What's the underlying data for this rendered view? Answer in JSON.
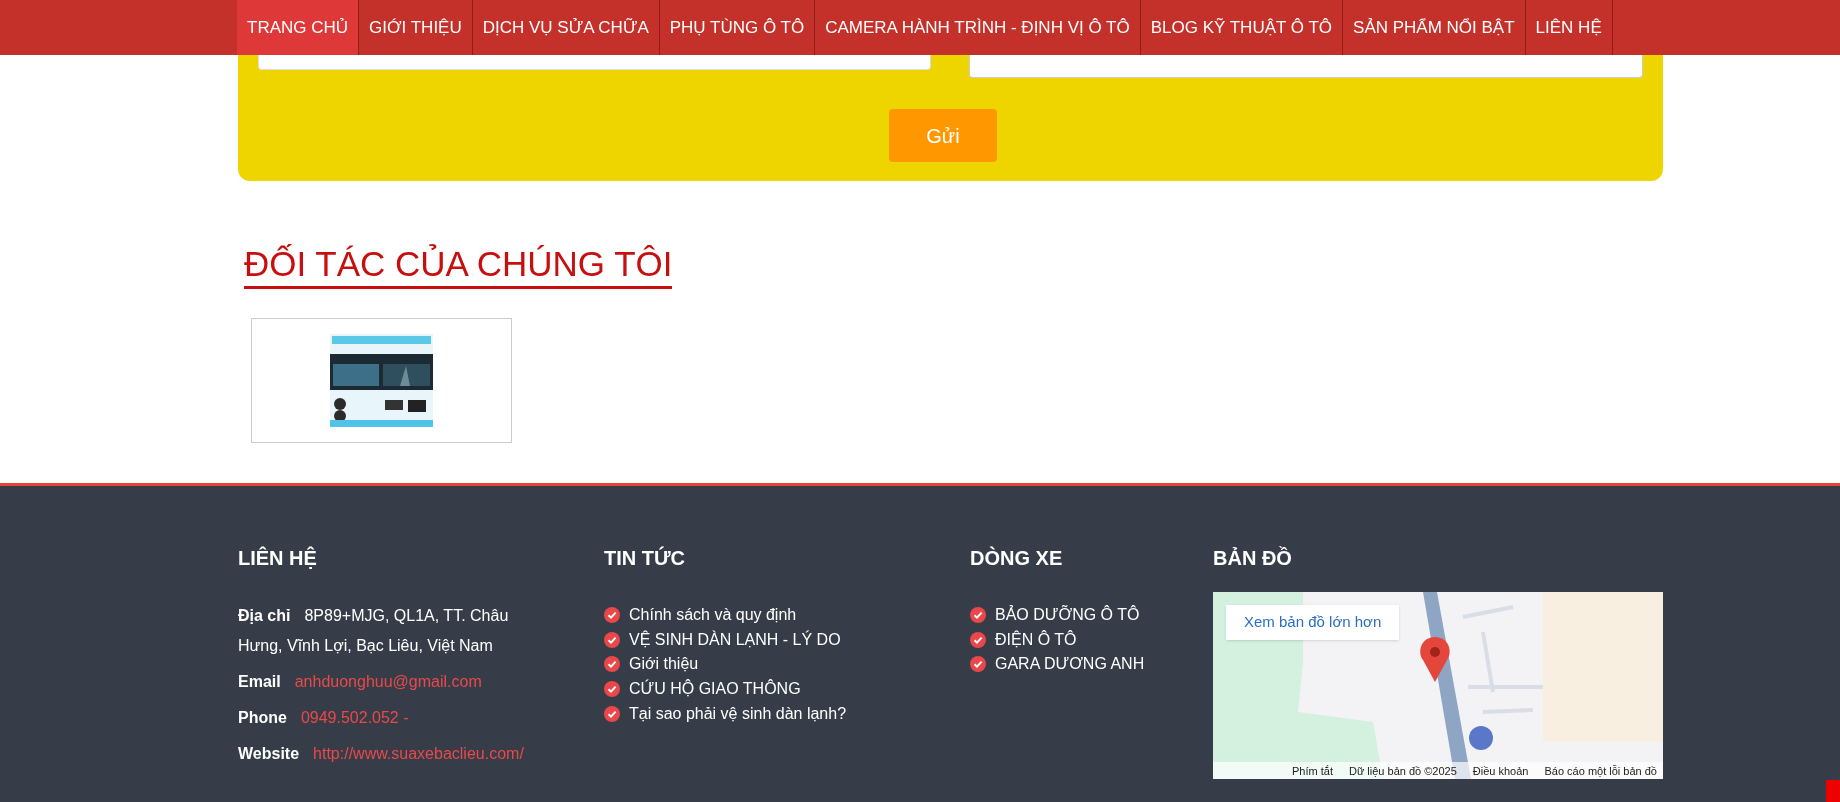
{
  "nav": {
    "items": [
      {
        "label": "TRANG CHỦ",
        "selected": true
      },
      {
        "label": "GIỚI THIỆU",
        "selected": false
      },
      {
        "label": "DỊCH VỤ SỬA CHỮA",
        "selected": false
      },
      {
        "label": "PHỤ TÙNG Ô TÔ",
        "selected": false
      },
      {
        "label": "CAMERA HÀNH TRÌNH - ĐỊNH VỊ Ô TÔ",
        "selected": false
      },
      {
        "label": "BLOG KỸ THUẬT Ô TÔ",
        "selected": false
      },
      {
        "label": "SẢN PHẨM NỔI BẬT",
        "selected": false
      },
      {
        "label": "LIÊN HỆ",
        "selected": false
      }
    ]
  },
  "contact_form": {
    "submit_button": "Gửi"
  },
  "partners": {
    "title": "ĐỐI TÁC CỦA CHÚNG TÔI"
  },
  "footer": {
    "contact": {
      "title": "LIÊN HỆ",
      "rows": [
        {
          "label": "Địa chỉ",
          "value": "8P89+MJG, QL1A, TT. Châu Hưng, Vĩnh Lợi, Bạc Liêu, Việt Nam",
          "kind": "text"
        },
        {
          "label": "Email",
          "value": "anhduonghuu@gmail.com",
          "kind": "link"
        },
        {
          "label": "Phone",
          "value": "0949.502.052 -",
          "kind": "link"
        },
        {
          "label": "Website",
          "value": "http://www.suaxebaclieu.com/",
          "kind": "link"
        }
      ]
    },
    "news": {
      "title": "TIN TỨC",
      "items": [
        "Chính sách và quy định",
        "VỆ SINH DÀN LẠNH - LÝ DO",
        "Giới thiệu",
        "CỨU HỘ GIAO THÔNG",
        "Tại sao phải vệ sinh dàn lạnh?"
      ]
    },
    "car_lines": {
      "title": "DÒNG XE",
      "items": [
        "BẢO DƯỠNG Ô TÔ",
        "ĐIỆN Ô TÔ",
        "GARA DƯƠNG ANH"
      ]
    },
    "map": {
      "title": "BẢN ĐỒ",
      "larger_map_link": "Xem bản đồ lớn hơn",
      "attribution": [
        "Phím tắt",
        "Dữ liệu bản đồ ©2025",
        "Điều khoản",
        "Báo cáo một lỗi bản đồ"
      ]
    }
  }
}
